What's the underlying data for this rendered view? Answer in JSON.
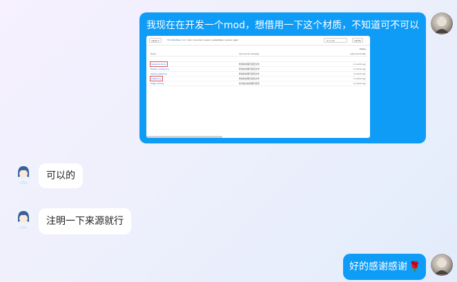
{
  "messages": [
    {
      "sender": "me",
      "text": "我现在在开发一个mod，想借用一下这个材质，不知道可不可以"
    },
    {
      "sender": "other",
      "text": "可以的"
    },
    {
      "sender": "other",
      "text": "注明一下来源就行"
    },
    {
      "sender": "me",
      "text": "好的感谢感谢",
      "emoji": "🌹"
    }
  ],
  "attachment": {
    "kind": "repository-screenshot",
    "branch": "master",
    "path_prefix": "TAC-BoldSkies /",
    "path_parts": [
      "src",
      "main",
      "resources",
      "assets",
      "justaddlittles",
      "textures",
      "gui"
    ],
    "path_end": "/",
    "search_placeholder": "Go to file",
    "add_file_label": "Add file",
    "history_label": "History",
    "headers": {
      "name": "Name",
      "commit": "Last commit message",
      "date": "Last commit date"
    },
    "files": [
      {
        "name": "background.png",
        "commit": "修改新纹理与配置文件",
        "date": "4 months ago",
        "highlighted": true
      },
      {
        "name": "blanket_overlay.png",
        "commit": "修改新纹理与配置文件",
        "date": "4 months ago",
        "highlighted": false
      },
      {
        "name": "blanket_plaid.png",
        "commit": "修改新纹理与配置文件",
        "date": "4 months ago",
        "highlighted": false
      },
      {
        "name": "widget.png",
        "commit": "修改新纹理与配置文件",
        "date": "4 months ago",
        "highlighted": true
      },
      {
        "name": "widget_alt.png",
        "commit": "初次提交新纹理与配置",
        "date": "4 months ago",
        "highlighted": false
      }
    ]
  },
  "colors": {
    "my_bubble": "#0e9cf7",
    "other_bubble": "#ffffff",
    "background_start": "#f6f0ff",
    "background_end": "#e2ecfb"
  },
  "icons": {
    "me_avatar": "user-avatar-icon",
    "other_avatar": "anime-character-avatar-icon",
    "emoji": "rose-icon"
  }
}
